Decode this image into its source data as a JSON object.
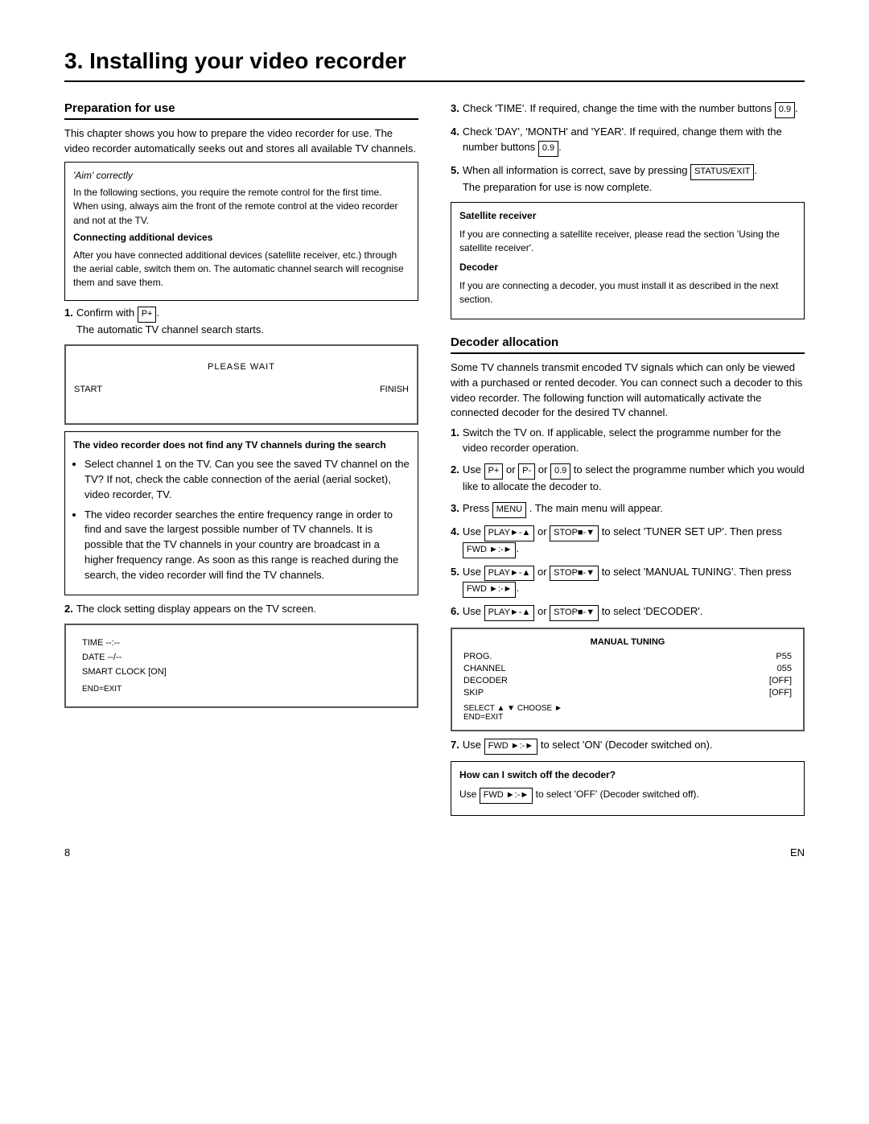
{
  "page": {
    "title": "3. Installing your video recorder",
    "page_number": "8",
    "locale": "EN"
  },
  "left_section": {
    "heading": "Preparation for use",
    "intro": "This chapter shows you how to prepare the video recorder for use. The video recorder automatically seeks out and stores all available TV channels.",
    "aim_label": "'Aim' correctly",
    "aim_text": "In the following sections, you require the remote control for the first time. When using, always aim the front of the remote control at the video recorder and not at the TV.",
    "connecting_label": "Connecting additional devices",
    "connecting_text": "After you have connected additional devices (satellite receiver, etc.) through the aerial cable, switch them on. The automatic channel search will recognise them and save them.",
    "step1_prefix": "1.",
    "step1_text": "Confirm with",
    "step1_key": "P+",
    "step1_sub": "The automatic TV channel search starts.",
    "screen1": {
      "please_wait": "PLEASE WAIT",
      "start": "START",
      "finish": "FINISH"
    },
    "warning_box": {
      "bold_text": "The video recorder does not find any TV channels during the search",
      "bullets": [
        "Select channel 1 on the TV. Can you see the saved TV channel on the TV? If not, check the cable connection of the aerial (aerial socket), video recorder, TV.",
        "The video recorder searches the entire frequency range in order to find and save the largest possible number of TV channels. It is possible that the TV channels in your country are broadcast in a higher frequency range. As soon as this range is reached during the search, the video recorder will find the TV channels."
      ]
    },
    "step2_prefix": "2.",
    "step2_text": "The clock setting display appears on the TV screen.",
    "screen2": {
      "time_label": "TIME --:--",
      "date_label": "DATE --/--",
      "smart_clock": "SMART CLOCK [ON]",
      "footer": "END=EXIT"
    },
    "step3_prefix": "3.",
    "step3_text": "Check 'TIME'. If required, change the time with the number buttons",
    "step3_key": "0.9",
    "step4_prefix": "4.",
    "step4_text": "Check 'DAY', 'MONTH' and 'YEAR'. If required, change them with the number buttons",
    "step4_key": "0.9",
    "step4_suffix": ".",
    "step5_prefix": "5.",
    "step5_text": "When all information is correct, save by pressing",
    "step5_key": "STATUS/EXIT",
    "step5_suffix": ".",
    "step5_end": "The preparation for use is now complete.",
    "info_box": {
      "satellite_label": "Satellite receiver",
      "satellite_text": "If you are connecting a satellite receiver, please read the section 'Using the satellite receiver'.",
      "decoder_label": "Decoder",
      "decoder_text": "If you are connecting a decoder, you must install it as described in the next section."
    }
  },
  "right_section": {
    "heading": "Decoder allocation",
    "intro": "Some TV channels transmit encoded TV signals which can only be viewed with a purchased or rented decoder. You can connect such a decoder to this video recorder. The following function will automatically activate the connected decoder for the desired TV channel.",
    "step1_prefix": "1.",
    "step1_text": "Switch the TV on. If applicable, select the programme number for the video recorder operation.",
    "step2_prefix": "2.",
    "step2_text": "Use",
    "step2_key1": "P+",
    "step2_key2": "P-",
    "step2_middle": "or",
    "step2_key3": "0.9",
    "step2_end": "to select the programme number which you would like to allocate the decoder to.",
    "step3_prefix": "3.",
    "step3_text": "Press",
    "step3_key": "MENU",
    "step3_end": ". The main menu will appear.",
    "step4_prefix": "4.",
    "step4_text": "Use",
    "step4_key1": "PLAY►-▲",
    "step4_middle": "or",
    "step4_key2": "STOP■-▼",
    "step4_end": "to select 'TUNER SET UP'. Then press",
    "step4_key3": "FWD ►:-►",
    "step4_period": ".",
    "step5_prefix": "5.",
    "step5_text": "Use",
    "step5_key1": "PLAY►-▲",
    "step5_middle": "or",
    "step5_key2": "STOP■-▼",
    "step5_end": "to select 'MANUAL TUNING'. Then press",
    "step5_key3": "FWD ►:-►",
    "step5_period": ".",
    "step6_prefix": "6.",
    "step6_text": "Use",
    "step6_key1": "PLAY►-▲",
    "step6_middle": "or",
    "step6_key2": "STOP■-▼",
    "step6_end": "to select 'DECODER'.",
    "screen3": {
      "title": "MANUAL TUNING",
      "rows": [
        {
          "label": "PROG.",
          "value": "P55"
        },
        {
          "label": "CHANNEL",
          "value": "055"
        },
        {
          "label": "DECODER",
          "value": "[OFF]"
        },
        {
          "label": "SKIP",
          "value": "[OFF]"
        }
      ],
      "footer1": "SELECT ▲ ▼  CHOOSE ►",
      "footer2": "END=EXIT"
    },
    "step7_prefix": "7.",
    "step7_text": "Use",
    "step7_key": "FWD ►:-►",
    "step7_end": "to select 'ON' (Decoder switched on).",
    "how_box": {
      "title": "How can I switch off the decoder?",
      "text": "Use",
      "key": "FWD ►:-►",
      "end": "to select 'OFF' (Decoder switched off)."
    }
  }
}
